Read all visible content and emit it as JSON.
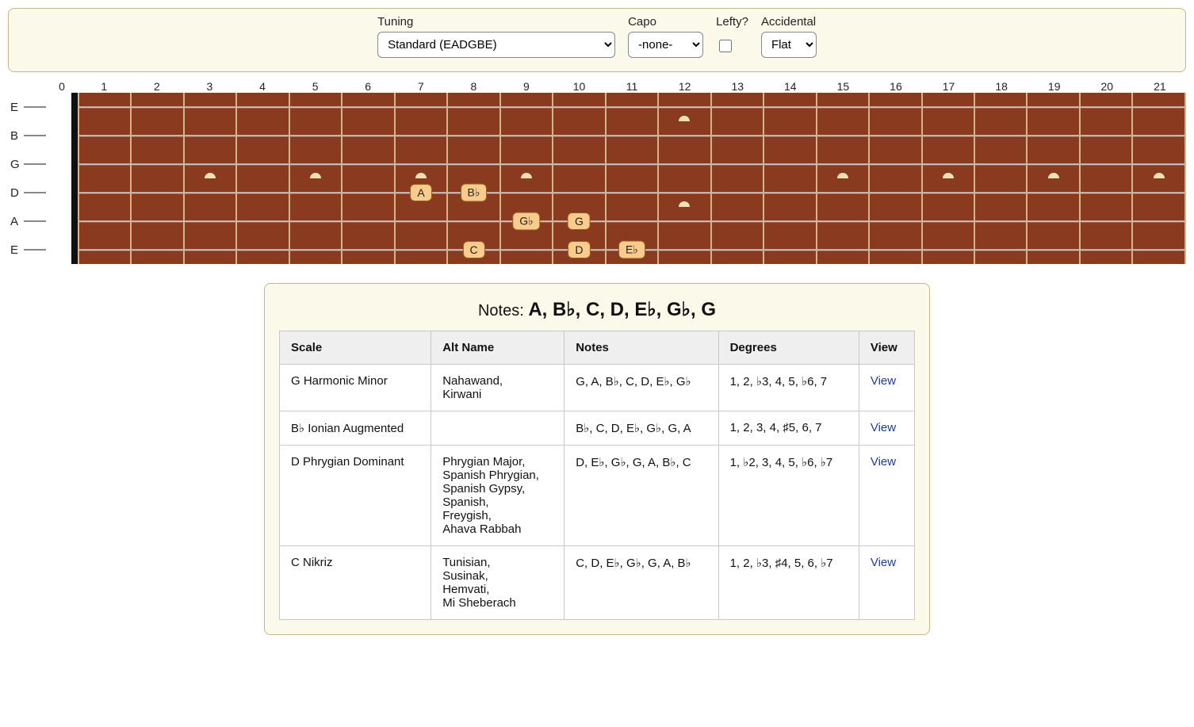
{
  "controls": {
    "tuning_label": "Tuning",
    "tuning_value": "Standard (EADGBE)",
    "capo_label": "Capo",
    "capo_value": "-none-",
    "lefty_label": "Lefty?",
    "lefty_checked": false,
    "accidental_label": "Accidental",
    "accidental_value": "Flat"
  },
  "fretboard": {
    "fret_count": 21,
    "open_strings": [
      "E",
      "B",
      "G",
      "D",
      "A",
      "E"
    ],
    "single_dot_frets": [
      3,
      5,
      7,
      9,
      15,
      17,
      19,
      21
    ],
    "double_dot_frets": [
      12
    ],
    "notes": [
      {
        "string_index": 3,
        "fret": 7,
        "label": "A"
      },
      {
        "string_index": 3,
        "fret": 8,
        "label": "B♭"
      },
      {
        "string_index": 4,
        "fret": 9,
        "label": "G♭"
      },
      {
        "string_index": 4,
        "fret": 10,
        "label": "G"
      },
      {
        "string_index": 5,
        "fret": 8,
        "label": "C"
      },
      {
        "string_index": 5,
        "fret": 10,
        "label": "D"
      },
      {
        "string_index": 5,
        "fret": 11,
        "label": "E♭"
      }
    ]
  },
  "results": {
    "notes_prefix": "Notes: ",
    "notes_display": "A, B♭, C, D, E♭, G♭, G",
    "headers": [
      "Scale",
      "Alt Name",
      "Notes",
      "Degrees",
      "View"
    ],
    "view_label": "View",
    "rows": [
      {
        "scale": "G Harmonic Minor",
        "alt": "Nahawand, Kirwani",
        "notes": "G, A, B♭, C, D, E♭, G♭",
        "degrees": "1, 2, ♭3, 4, 5, ♭6, 7"
      },
      {
        "scale": "B♭ Ionian Augmented",
        "alt": "",
        "notes": "B♭, C, D, E♭, G♭, G, A",
        "degrees": "1, 2, 3, 4, ♯5, 6, 7"
      },
      {
        "scale": "D Phrygian Dominant",
        "alt": "Phrygian Major, Spanish Phrygian, Spanish Gypsy, Spanish, Freygish, Ahava Rabbah",
        "notes": "D, E♭, G♭, G, A, B♭, C",
        "degrees": "1, ♭2, 3, 4, 5, ♭6, ♭7"
      },
      {
        "scale": "C Nikriz",
        "alt": "Tunisian, Susinak, Hemvati, Mi Sheberach",
        "notes": "C, D, E♭, G♭, G, A, B♭",
        "degrees": "1, 2, ♭3, ♯4, 5, 6, ♭7"
      }
    ]
  }
}
